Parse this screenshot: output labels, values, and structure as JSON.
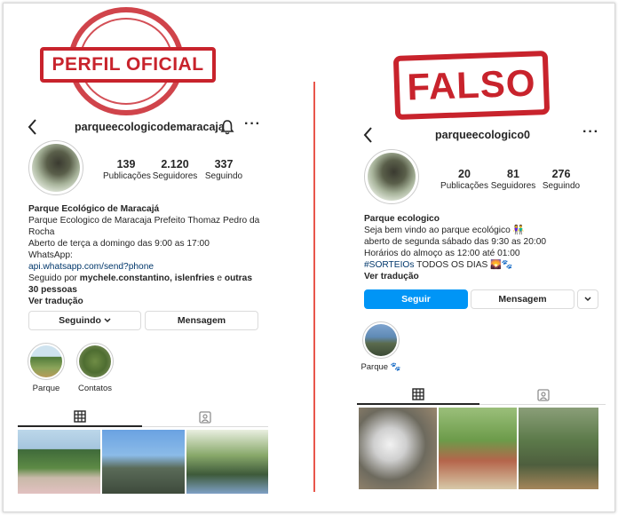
{
  "stamps": {
    "official": "PERFIL OFICIAL",
    "fake": "FALSO"
  },
  "left": {
    "username": "parqueecologicodemaracaja",
    "stats": [
      {
        "num": "139",
        "label": "Publicações"
      },
      {
        "num": "2.120",
        "label": "Seguidores"
      },
      {
        "num": "337",
        "label": "Seguindo"
      }
    ],
    "bio": {
      "name": "Parque Ecológico de Maracajá",
      "line1": "Parque Ecologico de Maracaja Prefeito Thomaz Pedro da Rocha",
      "line2": "Aberto de terça a domingo das 9:00 as 17:00",
      "line3": "WhatsApp:",
      "link": "api.whatsapp.com/send?phone",
      "followed_prefix": "Seguido por ",
      "followed_names": "mychele.constantino, islenfries",
      "followed_mid": " e ",
      "followed_rest": "outras 30 pessoas",
      "translate": "Ver tradução"
    },
    "buttons": {
      "following": "Seguindo",
      "message": "Mensagem"
    },
    "highlights": [
      {
        "label": "Parque"
      },
      {
        "label": "Contatos"
      }
    ]
  },
  "right": {
    "username": "parqueecologico0",
    "stats": [
      {
        "num": "20",
        "label": "Publicações"
      },
      {
        "num": "81",
        "label": "Seguidores"
      },
      {
        "num": "276",
        "label": "Seguindo"
      }
    ],
    "bio": {
      "name": "Parque ecologico",
      "line1": "Seja bem vindo ao parque ecológico 👫",
      "line2": "aberto de segunda sábado das 9:30 as 20:00",
      "line3": "Horários do almoço as 12:00 até 01:00",
      "hashtag": "#SORTEIOs",
      "line4_rest": " TODOS OS DIAS 🌄🐾",
      "translate": "Ver tradução"
    },
    "buttons": {
      "follow": "Seguir",
      "message": "Mensagem"
    },
    "highlights": [
      {
        "label": "Parque 🐾"
      }
    ]
  },
  "icons": [
    "back-icon",
    "bell-icon",
    "more-icon",
    "grid-icon",
    "tagged-icon",
    "chevron-down-icon"
  ],
  "colors": {
    "stamp": "#c8232c",
    "primary": "#0095f6",
    "divider": "#e8564b"
  }
}
